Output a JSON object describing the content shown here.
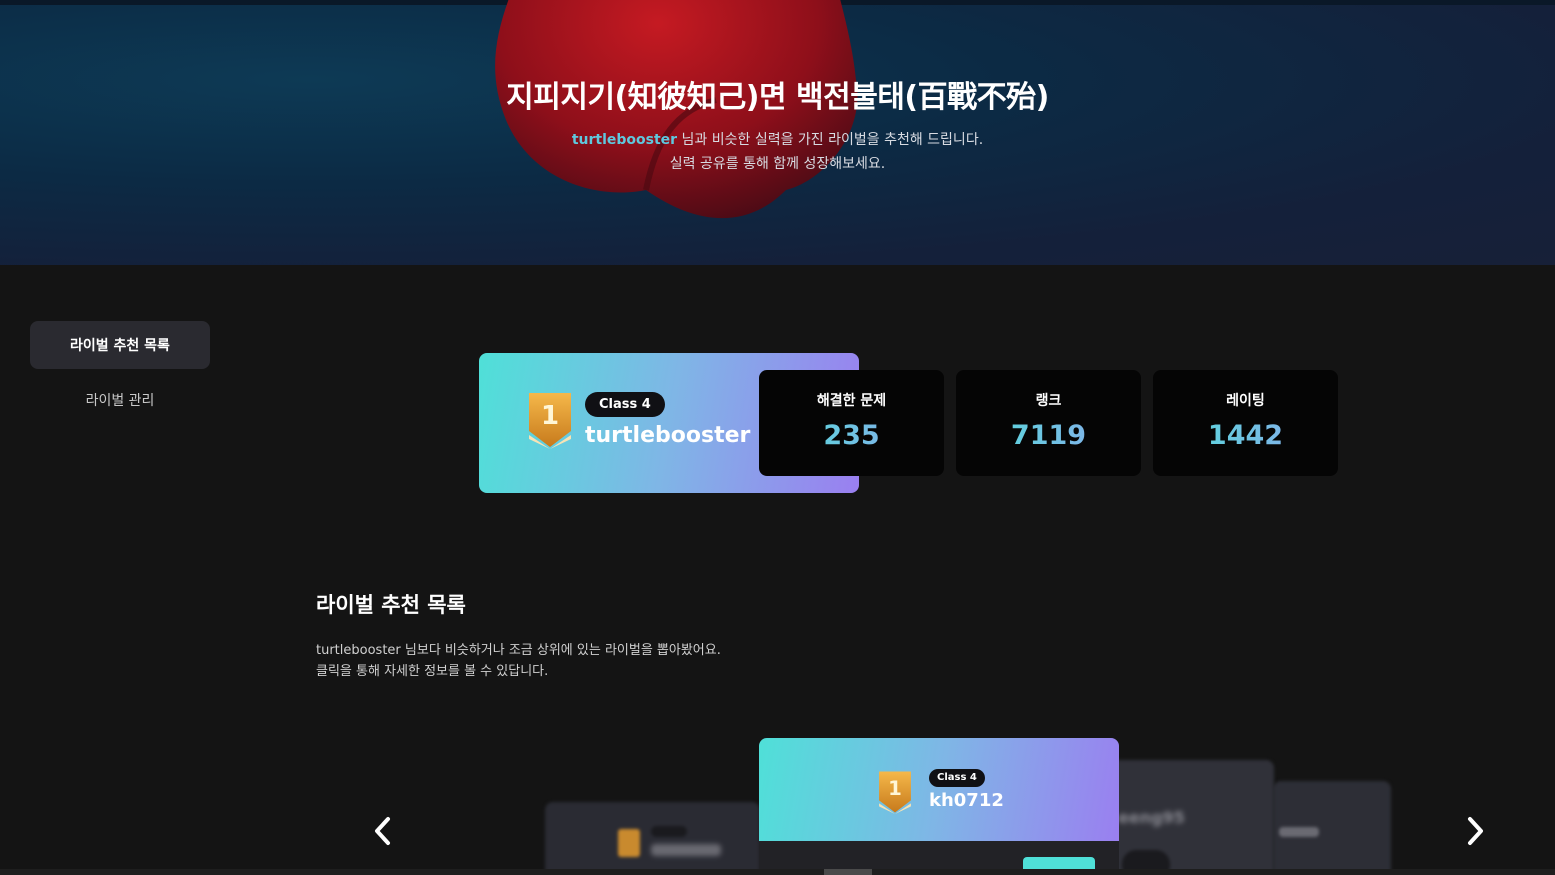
{
  "hero": {
    "title": "지피지기(知彼知己)면 백전불태(百戰不殆)",
    "username": "turtlebooster",
    "subtitle_line1_rest": " 님과 비슷한 실력을 가진 라이벌을 추천해 드립니다.",
    "subtitle_line2": "실력 공유를 통해 함께 성장해보세요."
  },
  "sidebar": {
    "items": [
      {
        "label": "라이벌 추천 목록",
        "active": true
      },
      {
        "label": "라이벌 관리",
        "active": false
      }
    ]
  },
  "profile": {
    "tier_number": "1",
    "class_label": "Class 4",
    "name": "turtlebooster",
    "stats": [
      {
        "label": "해결한 문제",
        "value": "235"
      },
      {
        "label": "랭크",
        "value": "7119"
      },
      {
        "label": "레이팅",
        "value": "1442"
      }
    ]
  },
  "section": {
    "title": "라이벌 추천 목록",
    "desc_line1": "turtlebooster 님보다 비슷하거나 조금 상위에 있는 라이벌을 뽑아봤어요.",
    "desc_line2": "클릭을 통해 자세한 정보를 볼 수 있답니다."
  },
  "carousel": {
    "current": {
      "tier_number": "1",
      "class_label": "Class 4",
      "name": "kh0712"
    },
    "right_peek_name": "eeng95"
  },
  "colors": {
    "accent_cyan": "#4fe0d8",
    "accent_purple": "#9a7ff0",
    "background": "#141414",
    "badge_gold": "#e6a23c"
  },
  "icons": {
    "prev": "chevron-left-icon",
    "next": "chevron-right-icon",
    "tier": "tier-badge-icon"
  }
}
